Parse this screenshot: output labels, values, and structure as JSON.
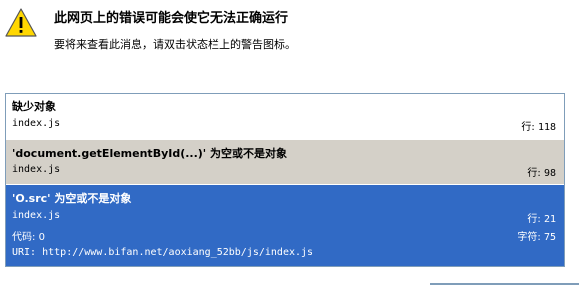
{
  "header": {
    "title": "此网页上的错误可能会使它无法正确运行",
    "description": "要将来查看此消息，请双击状态栏上的警告图标。"
  },
  "errors": [
    {
      "message": "缺少对象",
      "file": "index.js",
      "line_label": "行:",
      "line": "118"
    },
    {
      "message": "'document.getElementById(...)' 为空或不是对象",
      "file": "index.js",
      "line_label": "行:",
      "line": "98"
    },
    {
      "message": "'O.src' 为空或不是对象",
      "file": "index.js",
      "line_label": "行:",
      "line": "21",
      "code_label": "代码:",
      "code": "0",
      "char_label": "字符:",
      "char": "75",
      "url_label": "URI:",
      "url": "http://www.bifan.net/aoxiang_52bb/js/index.js"
    }
  ],
  "selected_index": 2,
  "colors": {
    "selection": "#316ac5",
    "alternate_row": "#d4d0c8",
    "warning_fill": "#ffd700"
  },
  "icons": [
    "warning-icon"
  ]
}
